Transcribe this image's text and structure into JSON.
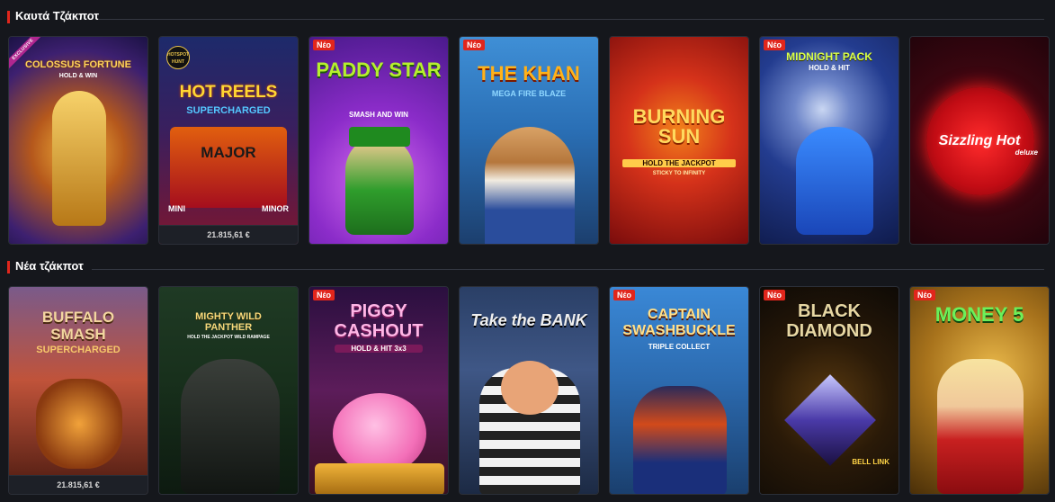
{
  "sections": [
    {
      "title": "Καυτά Τζάκποτ",
      "games": [
        {
          "logo": "COLOSSUS FORTUNE",
          "sub": "HOLD & WIN",
          "badge": "",
          "ribbon": "EXCLUSIVE",
          "jackpot": ""
        },
        {
          "logo": "HOT REELS",
          "sub": "SUPERCHARGED",
          "extra1": "MAJOR",
          "extra2": "MINI",
          "extra3": "MINOR",
          "corner": "HOTSPOT HUNT",
          "badge": "",
          "jackpot": "21.815,61 €"
        },
        {
          "logo": "PADDY STAR",
          "sub": "SMASH AND WIN",
          "badge": "Νέο",
          "jackpot": ""
        },
        {
          "logo": "THE KHAN",
          "sub": "MEGA FIRE BLAZE",
          "badge": "Νέο",
          "jackpot": ""
        },
        {
          "logo": "BURNING SUN",
          "sub": "HOLD THE JACKPOT",
          "sub2": "STICKY TO INFINITY",
          "badge": "",
          "jackpot": ""
        },
        {
          "logo": "MIDNIGHT PACK",
          "sub": "HOLD & HIT",
          "badge": "Νέο",
          "jackpot": ""
        },
        {
          "logo": "Sizzling Hot",
          "sub": "deluxe",
          "badge": "",
          "jackpot": ""
        }
      ]
    },
    {
      "title": "Νέα τζάκποτ",
      "games": [
        {
          "logo": "BUFFALO SMASH",
          "sub": "SUPERCHARGED",
          "badge": "",
          "jackpot": "21.815,61 €"
        },
        {
          "logo": "MIGHTY WILD",
          "logo2": "PANTHER",
          "sub": "HOLD THE JACKPOT WILD RAMPAGE",
          "badge": "",
          "jackpot": ""
        },
        {
          "logo": "PIGGY CASHOUT",
          "sub": "HOLD & HIT 3x3",
          "badge": "Νέο",
          "jackpot": ""
        },
        {
          "logo": "Take the BANK",
          "sub": "",
          "badge": "",
          "jackpot": ""
        },
        {
          "logo": "CAPTAIN SWASHBUCKLE",
          "sub": "TRIPLE COLLECT",
          "badge": "Νέο",
          "jackpot": ""
        },
        {
          "logo": "BLACK DIAMOND",
          "sub": "BELL LINK",
          "badge": "Νέο",
          "jackpot": ""
        },
        {
          "logo": "MONEY 5",
          "sub": "",
          "badge": "Νέο",
          "jackpot": ""
        }
      ]
    }
  ]
}
